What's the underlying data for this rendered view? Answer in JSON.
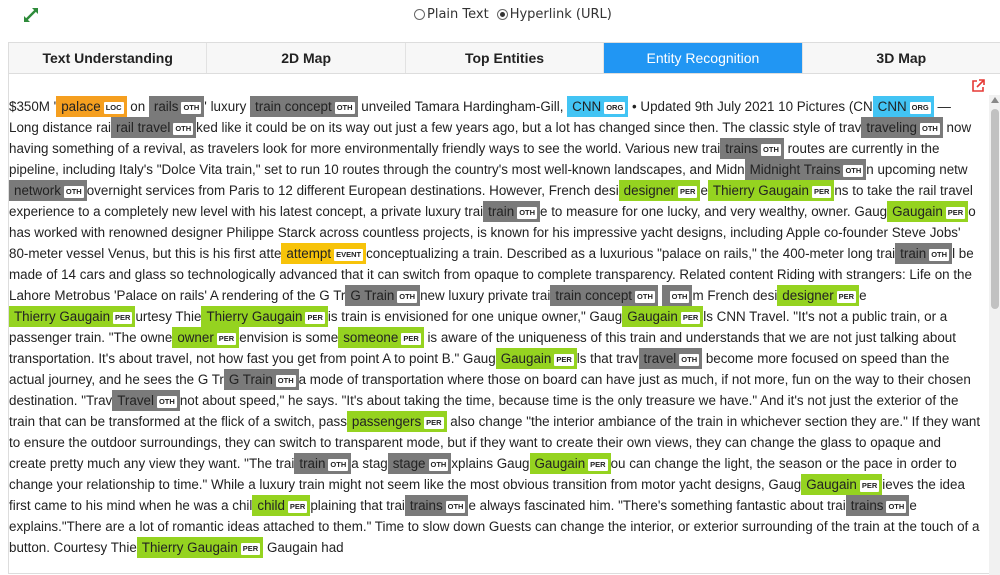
{
  "radios": [
    {
      "label": "Plain Text",
      "checked": false
    },
    {
      "label": "Hyperlink (URL)",
      "checked": true
    }
  ],
  "tabs": [
    "Text Understanding",
    "2D Map",
    "Top Entities",
    "Entity Recognition",
    "3D Map"
  ],
  "active_tab": "Entity Recognition",
  "colors": {
    "accent": "#2196f3",
    "OTH": "#7a7a7a",
    "PER": "#95d320",
    "ORG": "#42c4f4",
    "LOC": "#f59f1f",
    "EVENT": "#f7c30a"
  },
  "icons": {
    "expand": "expand-icon",
    "external": "external-link-icon"
  },
  "article": [
    {
      "t": "$350M '"
    },
    {
      "e": "palace",
      "l": "LOC"
    },
    {
      "t": " on "
    },
    {
      "e": "rails",
      "l": "OTH"
    },
    {
      "t": "' luxury "
    },
    {
      "e": "train concept",
      "l": "OTH"
    },
    {
      "t": " unveiled Tamara Hardingham-Gill, "
    },
    {
      "e": "CNN",
      "l": "ORG"
    },
    {
      "t": " • Updated 9th July 2021 10 Pictures (CN"
    },
    {
      "e": "CNN",
      "l": "ORG"
    },
    {
      "t": " — Long distance rai"
    },
    {
      "e": "rail travel",
      "l": "OTH"
    },
    {
      "t": "ked like it could be on its way out just a few years ago, but a lot has changed since then. The classic style of trav"
    },
    {
      "e": "traveling",
      "l": "OTH"
    },
    {
      "t": " now having something of a revival, as travelers look for more environmentally friendly ways to see the world. Various new trai"
    },
    {
      "e": "trains",
      "l": "OTH"
    },
    {
      "t": " routes are currently in the pipeline, including Italy's \"Dolce Vita train,\" set to run 10 routes through the country's most well-known landscapes, and Midn"
    },
    {
      "e": "Midnight Trains",
      "l": "OTH"
    },
    {
      "t": "n upcoming netw"
    },
    {
      "e": "network",
      "l": "OTH"
    },
    {
      "t": "overnight services from Paris to 12 different European destinations. However, French desi"
    },
    {
      "e": "designer",
      "l": "PER"
    },
    {
      "t": "e"
    },
    {
      "e": "Thierry Gaugain",
      "l": "PER"
    },
    {
      "t": "ns to take the rail travel experience to a completely new level with his latest concept, a private luxury trai"
    },
    {
      "e": "train",
      "l": "OTH"
    },
    {
      "t": "e to measure for one lucky, and very wealthy, owner. Gaug"
    },
    {
      "e": "Gaugain",
      "l": "PER"
    },
    {
      "t": "o has worked with renowned designer Philippe Starck across countless projects, is known for his impressive yacht designs, including Apple co-founder Steve Jobs' 80-meter vessel Venus, but this is his first atte"
    },
    {
      "e": "attempt",
      "l": "EVENT"
    },
    {
      "t": "conceptualizing a train. Described as a luxurious \"palace on rails,\" the 400-meter long trai"
    },
    {
      "e": "train",
      "l": "OTH"
    },
    {
      "t": "l be made of 14 cars and glass so technologically advanced that it can switch from opaque to complete transparency. Related content Riding with strangers: Life on the Lahore Metrobus 'Palace on rails' A rendering of the G Tr"
    },
    {
      "e": "G Train",
      "l": "OTH"
    },
    {
      "t": "new luxury private trai"
    },
    {
      "e": "train concept",
      "l": "OTH"
    },
    {
      "t": " "
    },
    {
      "e": "",
      "l": "OTH"
    },
    {
      "t": "m French desi"
    },
    {
      "e": "designer",
      "l": "PER"
    },
    {
      "t": "e"
    },
    {
      "e": "Thierry Gaugain",
      "l": "PER"
    },
    {
      "t": "urtesy Thie"
    },
    {
      "e": "Thierry Gaugain",
      "l": "PER"
    },
    {
      "t": "is train is envisioned for one unique owner,\" Gaug"
    },
    {
      "e": "Gaugain",
      "l": "PER"
    },
    {
      "t": "ls CNN Travel. \"It's not a public train, or a passenger train. \"The owne"
    },
    {
      "e": "owner",
      "l": "PER"
    },
    {
      "t": "envision is some"
    },
    {
      "e": "someone",
      "l": "PER"
    },
    {
      "t": " is aware of the uniqueness of this train and understands that we are not just talking about transportation. It's about travel, not how fast you get from point A to point B.\" Gaug"
    },
    {
      "e": "Gaugain",
      "l": "PER"
    },
    {
      "t": "ls that trav"
    },
    {
      "e": "travel",
      "l": "OTH"
    },
    {
      "t": " become more focused on speed than the actual journey, and he sees the G Tr"
    },
    {
      "e": "G Train",
      "l": "OTH"
    },
    {
      "t": "a mode of transportation where those on board can have just as much, if not more, fun on the way to their chosen destination. \"Trav"
    },
    {
      "e": "Travel",
      "l": "OTH"
    },
    {
      "t": "not about speed,\" he says. \"It's about taking the time, because time is the only treasure we have.\" And it's not just the exterior of the train that can be transformed at the flick of a switch, pass"
    },
    {
      "e": "passengers",
      "l": "PER"
    },
    {
      "t": " also change \"the interior ambiance of the train in whichever section they are.\" If they want to ensure the outdoor surroundings, they can switch to transparent mode, but if they want to create their own views, they can change the glass to opaque and create pretty much any view they want. \"The trai"
    },
    {
      "e": "train",
      "l": "OTH"
    },
    {
      "t": "a stag"
    },
    {
      "e": "stage",
      "l": "OTH"
    },
    {
      "t": "xplains Gaug"
    },
    {
      "e": "Gaugain",
      "l": "PER"
    },
    {
      "t": "ou can change the light, the season or the pace in order to change your relationship to time.\" While a luxury train might not seem like the most obvious transition from motor yacht designs, Gaug"
    },
    {
      "e": "Gaugain",
      "l": "PER"
    },
    {
      "t": "ieves the idea first came to his mind when he was a chil"
    },
    {
      "e": "child",
      "l": "PER"
    },
    {
      "t": "plaining that trai"
    },
    {
      "e": "trains",
      "l": "OTH"
    },
    {
      "t": "e always fascinated him. \"There's something fantastic about trai"
    },
    {
      "e": "trains",
      "l": "OTH"
    },
    {
      "t": "e explains.\"There are a lot of romantic ideas attached to them.\" Time to slow down Guests can change the interior, or exterior surrounding of the train at the touch of a button. Courtesy Thie"
    },
    {
      "e": "Thierry Gaugain",
      "l": "PER"
    },
    {
      "t": " Gaugain had"
    }
  ]
}
